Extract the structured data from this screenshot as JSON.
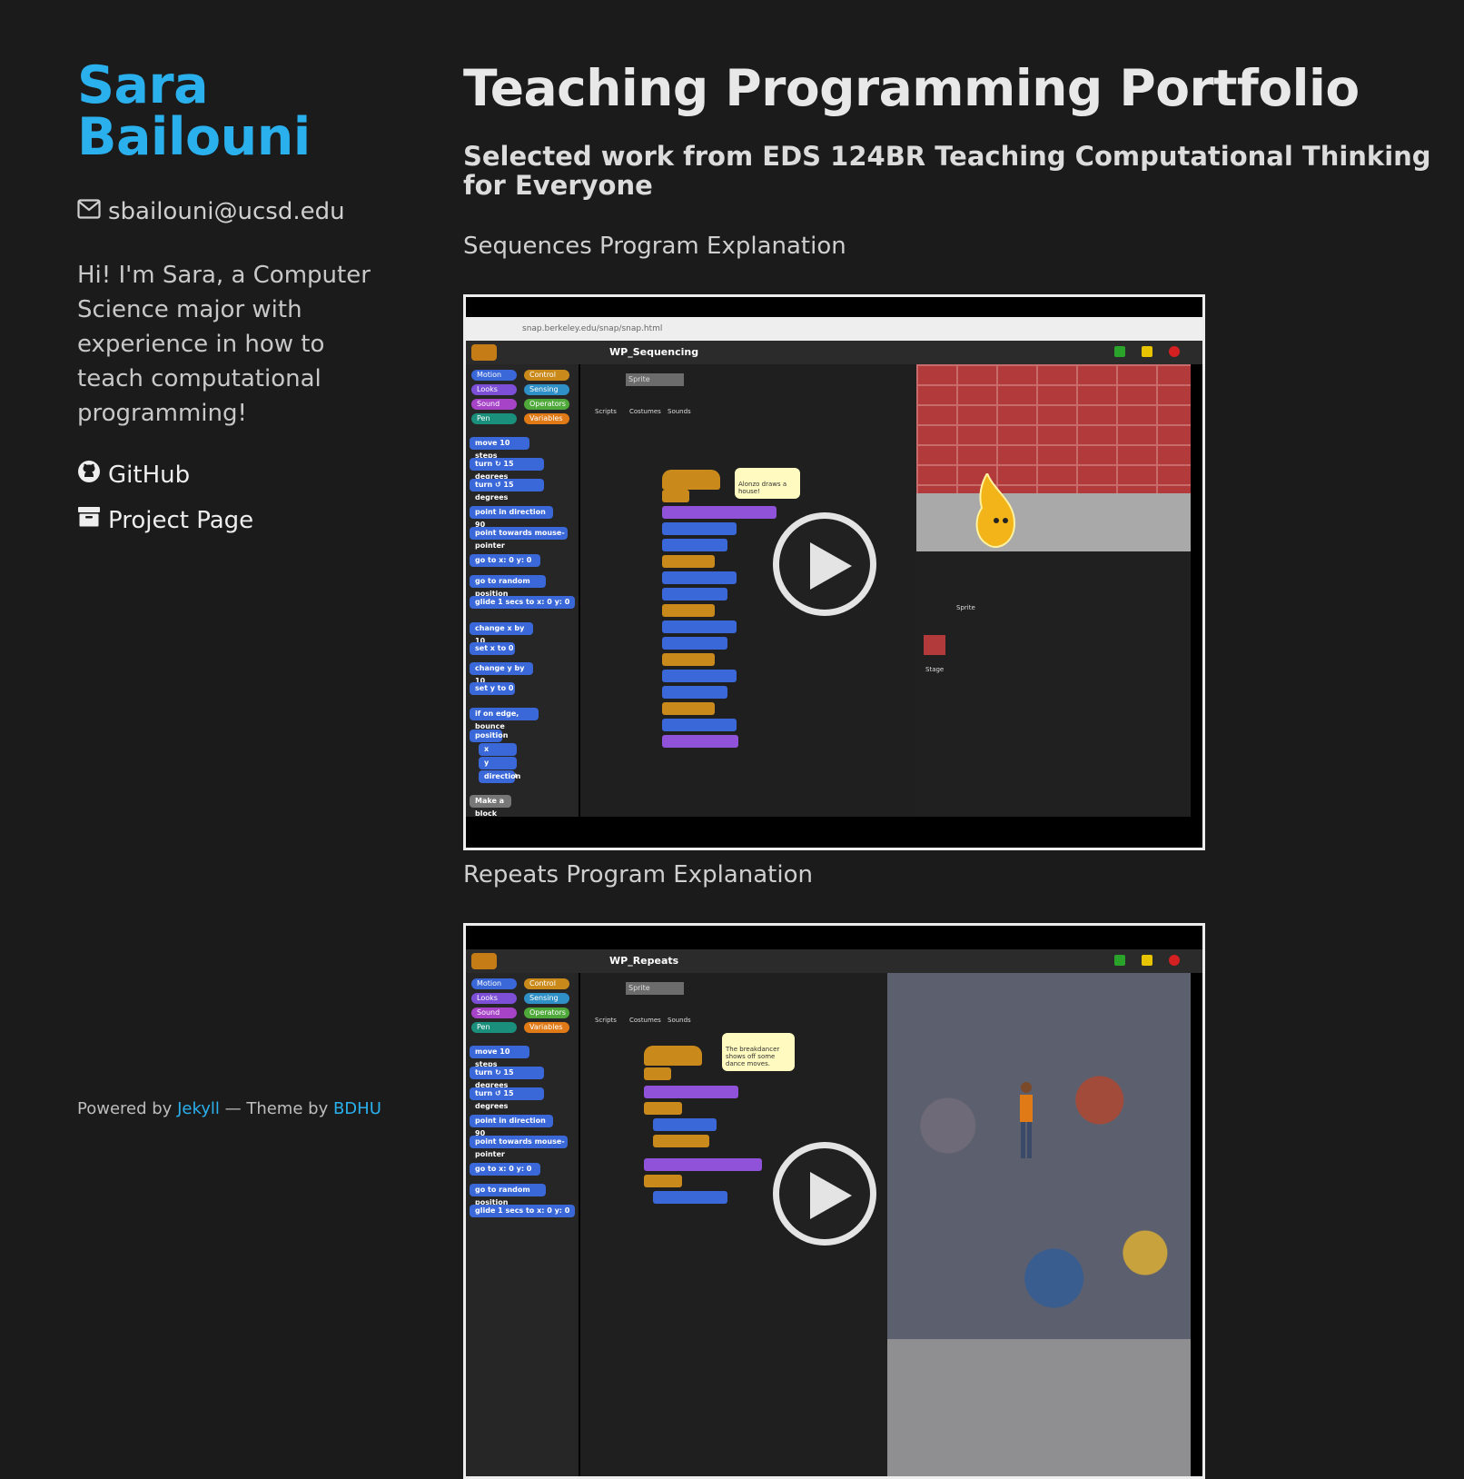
{
  "sidebar": {
    "name_line1": "Sara",
    "name_line2": "Bailouni",
    "email": "sbailouni@ucsd.edu",
    "bio": "Hi! I'm Sara, a Computer Science major with experience in how to teach computational programming!",
    "links": [
      {
        "label": "GitHub",
        "icon": "github-icon"
      },
      {
        "label": "Project Page",
        "icon": "archive-icon"
      }
    ],
    "footer": {
      "powered_by": "Powered by",
      "jekyll": "Jekyll",
      "theme_by": " — Theme by ",
      "bdhu": "BDHU"
    }
  },
  "main": {
    "title": "Teaching Programming Portfolio",
    "subtitle": "Selected work from EDS 124BR Teaching Computational Thinking for Everyone",
    "videos": [
      {
        "label": "Sequences Program Explanation",
        "url_text": "snap.berkeley.edu/snap/snap.html",
        "project": "WP_Sequencing",
        "sprite_name": "Sprite",
        "speech_note": "Alonzo draws a house!",
        "sprite_label": "Sprite",
        "stage_label": "Stage"
      },
      {
        "label": "Repeats Program Explanation",
        "project": "WP_Repeats",
        "sprite_name": "Sprite",
        "speech_note": "The breakdancer shows off some dance moves."
      }
    ],
    "snap_tabs": [
      "Scripts",
      "Costumes",
      "Sounds"
    ],
    "categories": [
      "Motion",
      "Looks",
      "Sound",
      "Pen",
      "Control",
      "Sensing",
      "Operators",
      "Variables"
    ],
    "blocks": [
      "move 10 steps",
      "turn ↻ 15 degrees",
      "turn ↺ 15 degrees",
      "point in direction 90",
      "point towards mouse-pointer",
      "go to x: 0 y: 0",
      "go to random position",
      "glide 1 secs to x: 0 y: 0",
      "change x by 10",
      "set x to 0",
      "change y by 10",
      "set y to 0",
      "if on edge, bounce",
      "position",
      "x position",
      "y position",
      "direction",
      "Make a block"
    ],
    "colors": {
      "accent": "#2bb0ee",
      "background": "#1b1b1c"
    }
  }
}
